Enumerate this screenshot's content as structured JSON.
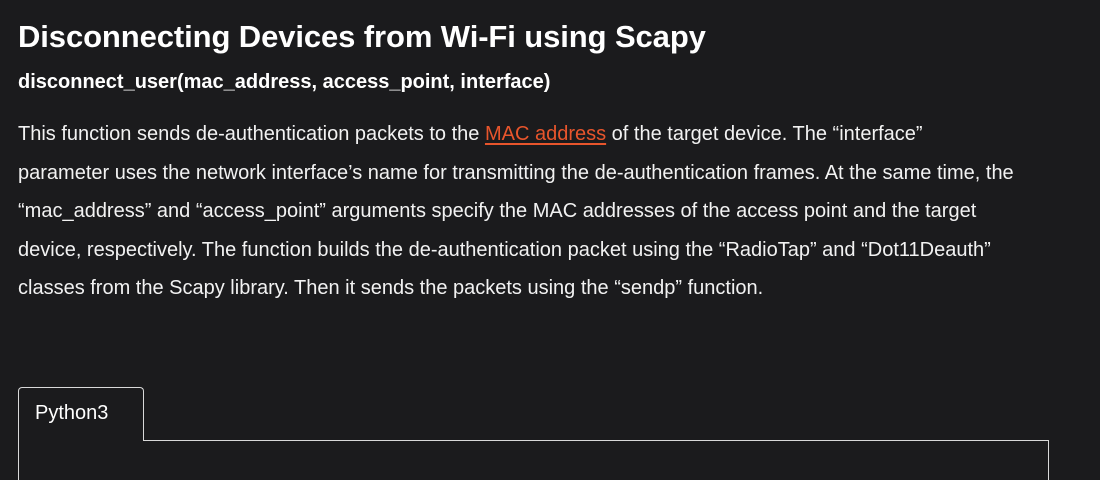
{
  "article": {
    "title": "Disconnecting Devices from Wi-Fi using Scapy",
    "signature": "disconnect_user(mac_address, access_point, interface)",
    "description": {
      "before_link": "This function sends de-authentication packets to the ",
      "link_text": "MAC address",
      "after_link": " of the target device. The “interface” parameter uses the network interface’s name for transmitting the de-authentication frames. At the same time, the “mac_address” and “access_point” arguments specify the MAC addresses of the access point and the target device, respectively. The function builds the de-authentication packet using the “RadioTap” and “Dot11Deauth” classes from the Scapy library. Then it sends the packets using the “sendp” function."
    }
  },
  "code": {
    "tabs": [
      {
        "label": "Python3"
      }
    ]
  },
  "colors": {
    "background": "#1b1b1d",
    "text": "#ffffff",
    "link": "#e8552c",
    "border": "#d9d9d9"
  }
}
